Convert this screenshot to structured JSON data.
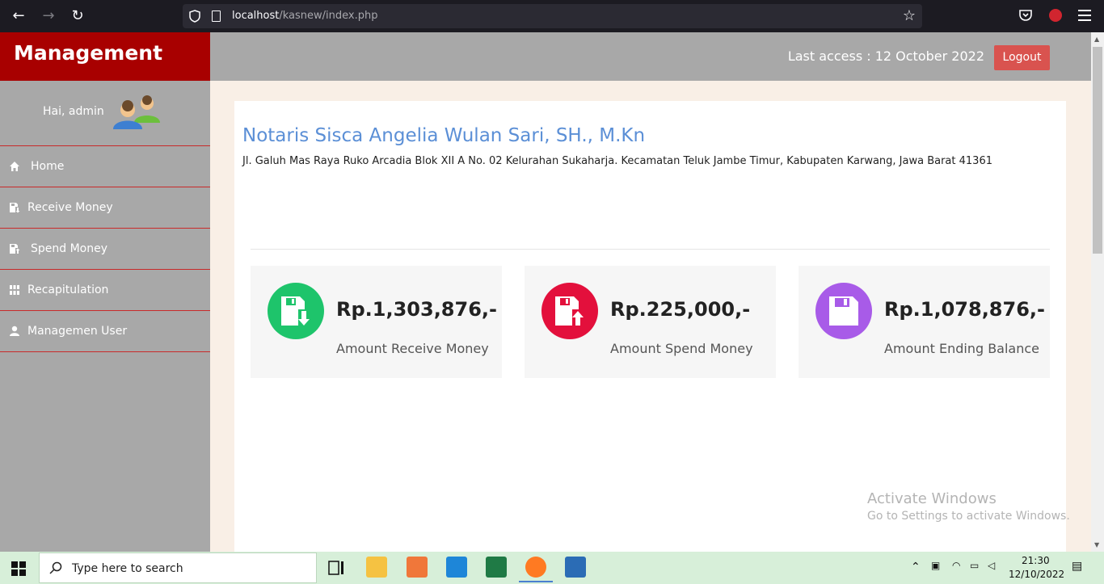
{
  "browser": {
    "url_host": "localhost",
    "url_path": "/kasnew/index.php"
  },
  "app": {
    "brand": "Management Cash",
    "last_access": "Last access : 12 October 2022",
    "logout_label": "Logout"
  },
  "sidebar": {
    "greeting": "Hai, admin",
    "items": [
      {
        "label": "Home",
        "icon": "home-icon"
      },
      {
        "label": "Receive Money",
        "icon": "receive-icon"
      },
      {
        "label": "Spend Money",
        "icon": "spend-icon"
      },
      {
        "label": "Recapitulation",
        "icon": "grid-icon"
      },
      {
        "label": "Managemen User",
        "icon": "user-icon"
      }
    ]
  },
  "main": {
    "title": "Notaris Sisca Angelia Wulan Sari, SH., M.Kn",
    "address": "Jl. Galuh Mas Raya Ruko Arcadia Blok XII A No. 02 Kelurahan Sukaharja. Kecamatan Teluk Jambe Timur, Kabupaten Karwang, Jawa Barat 41361",
    "stats": [
      {
        "value": "Rp.1,303,876,-",
        "label": "Amount Receive Money",
        "color": "#1ec46b"
      },
      {
        "value": "Rp.225,000,-",
        "label": "Amount Spend Money",
        "color": "#e3103c"
      },
      {
        "value": "Rp.1,078,876,-",
        "label": "Amount Ending Balance",
        "color": "#a85be8"
      }
    ]
  },
  "watermark": {
    "title": "Activate Windows",
    "subtitle": "Go to Settings to activate Windows."
  },
  "taskbar": {
    "search_placeholder": "Type here to search",
    "time": "21:30",
    "date": "12/10/2022"
  }
}
